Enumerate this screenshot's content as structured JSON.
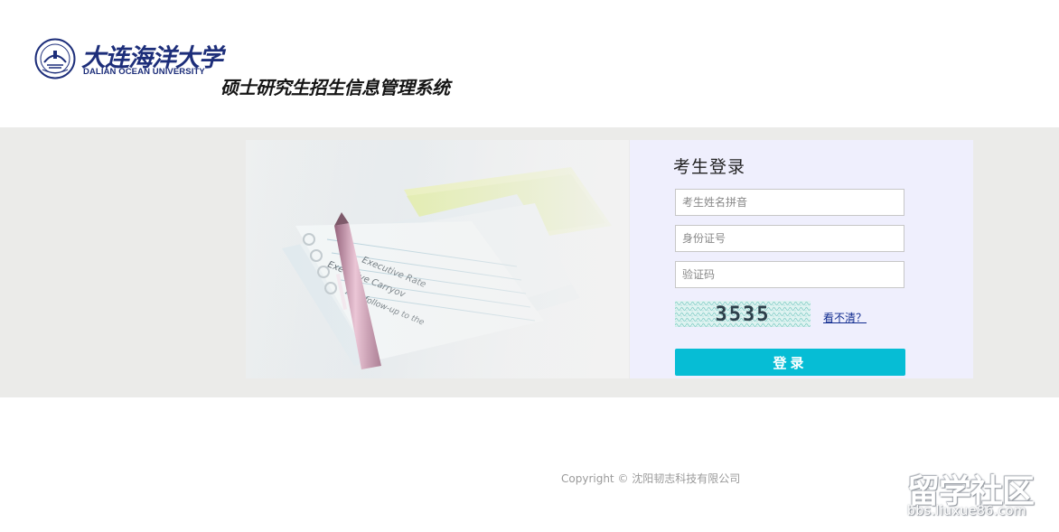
{
  "header": {
    "logo_cn": "大连海洋大学",
    "logo_en": "DALIAN OCEAN UNIVERSITY",
    "system_title": "硕士研究生招生信息管理系统"
  },
  "banner": {
    "image_name": "pen-and-documents-photo",
    "doc_lines": [
      "Executive Rate",
      "Executive Carryov",
      "As a follow-up to the"
    ]
  },
  "login": {
    "title": "考生登录",
    "name_placeholder": "考生姓名拼音",
    "id_placeholder": "身份证号",
    "code_placeholder": "验证码",
    "captcha_text": "3535",
    "refresh_label": "看不清？",
    "submit_label": "登录"
  },
  "footer": {
    "copyright": "Copyright © 沈阳韧志科技有限公司"
  },
  "watermark": {
    "text": "留学社区",
    "url": "bbs.liuxue86.com"
  },
  "colors": {
    "band_background": "#ebebe9",
    "login_panel": "#efeffd",
    "submit_button": "#06bdd5",
    "link": "#102b8f",
    "logo_blue": "#1d2e7a"
  }
}
